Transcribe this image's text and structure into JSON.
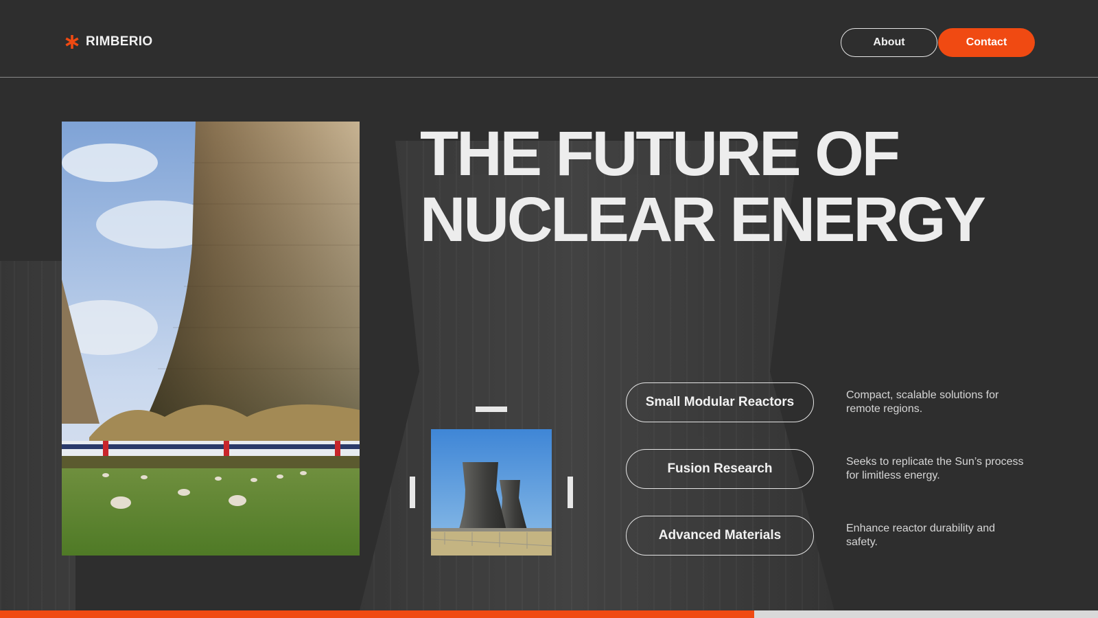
{
  "brand": {
    "name": "RIMBERIO",
    "logo_icon": "asterisk-icon"
  },
  "nav": {
    "about_label": "About",
    "contact_label": "Contact"
  },
  "hero": {
    "title_line1": "THE FUTURE OF",
    "title_line2": "NUCLEAR ENERGY"
  },
  "features": [
    {
      "label": "Small Modular Reactors",
      "description": "Compact, scalable solutions for remote regions."
    },
    {
      "label": "Fusion Research",
      "description": "Seeks to replicate the Sun’s process for limitless energy."
    },
    {
      "label": "Advanced Materials",
      "description": "Enhance reactor durability and safety."
    }
  ],
  "progress": {
    "fraction": 0.687
  },
  "colors": {
    "accent": "#f04a12",
    "background": "#2e2e2e",
    "text": "#ededed"
  }
}
